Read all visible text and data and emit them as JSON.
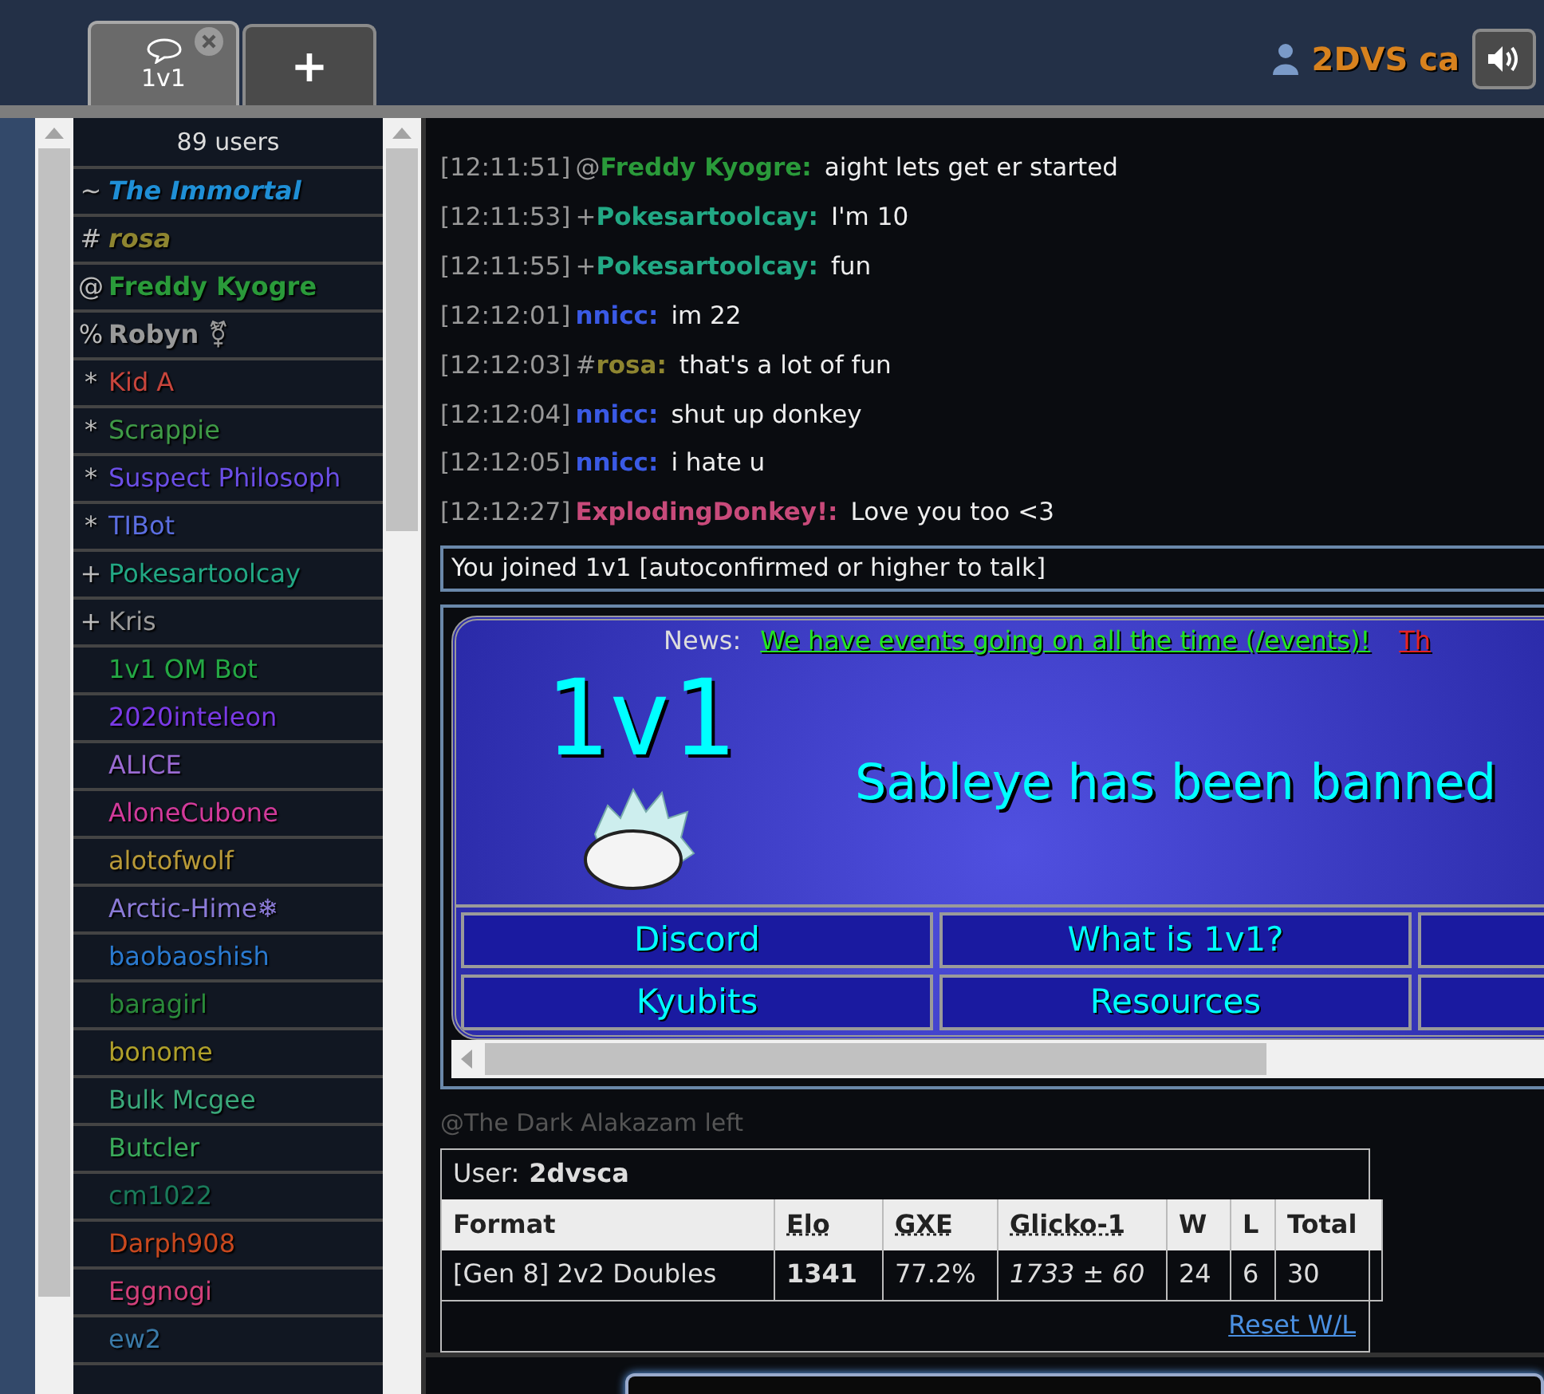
{
  "tabs": [
    {
      "kind": "room",
      "label": "1v1",
      "selected": true
    },
    {
      "kind": "new",
      "label": "+",
      "selected": false
    }
  ],
  "account": {
    "name": "2DVS ca"
  },
  "userlist": {
    "count": "89 users",
    "users": [
      {
        "rank": "~",
        "name": "The Immortal",
        "color": "#1f8fd6",
        "kind": "senior"
      },
      {
        "rank": "#",
        "name": "rosa",
        "color": "#8e8530",
        "kind": "senior"
      },
      {
        "rank": "@",
        "name": "Freddy Kyogre",
        "color": "#2a9a3a",
        "kind": "staff"
      },
      {
        "rank": "%",
        "name": "Robyn ⚧",
        "color": "#999999",
        "kind": "staff"
      },
      {
        "rank": "*",
        "name": "Kid A",
        "color": "#c8453c",
        "kind": "regular"
      },
      {
        "rank": "*",
        "name": "Scrappie",
        "color": "#3f9a46",
        "kind": "regular"
      },
      {
        "rank": "*",
        "name": "Suspect Philosoph",
        "color": "#6b4ee6",
        "kind": "regular"
      },
      {
        "rank": "*",
        "name": "TIBot",
        "color": "#5b6ee0",
        "kind": "regular"
      },
      {
        "rank": "+",
        "name": "Pokesartoolcay",
        "color": "#22a884",
        "kind": "regular"
      },
      {
        "rank": "+",
        "name": "Kris",
        "color": "#9a9a9a",
        "kind": "regular"
      },
      {
        "name": "1v1 OM Bot",
        "color": "#24a844",
        "kind": "regular"
      },
      {
        "name": "2020inteleon",
        "color": "#7a3ae6",
        "kind": "regular"
      },
      {
        "name": "ALICE",
        "color": "#9a6ad2",
        "kind": "regular"
      },
      {
        "name": "AloneCubone",
        "color": "#d23a9a",
        "kind": "regular"
      },
      {
        "name": "alotofwolf",
        "color": "#b89a38",
        "kind": "regular"
      },
      {
        "name": "Arctic-Hime❄",
        "color": "#8a7ad6",
        "kind": "regular"
      },
      {
        "name": "baobaoshish",
        "color": "#2a7ad0",
        "kind": "regular"
      },
      {
        "name": "baragirl",
        "color": "#2a8a3a",
        "kind": "regular"
      },
      {
        "name": "bonome",
        "color": "#b0a02a",
        "kind": "regular"
      },
      {
        "name": "Bulk Mcgee",
        "color": "#3aa87a",
        "kind": "regular"
      },
      {
        "name": "Butcler",
        "color": "#3aaa5a",
        "kind": "regular"
      },
      {
        "name": "cm1022",
        "color": "#1a7a5a",
        "kind": "regular"
      },
      {
        "name": "Darph908",
        "color": "#c8481e",
        "kind": "regular"
      },
      {
        "name": "Eggnogi",
        "color": "#d2407a",
        "kind": "regular"
      },
      {
        "name": "ew2",
        "color": "#3a7aa8",
        "kind": "regular"
      }
    ]
  },
  "chat": {
    "messages": [
      {
        "time": "[12:11:51]",
        "rank": "@",
        "user": "Freddy Kyogre:",
        "color": "#2a9a3a",
        "text": "aight lets get er started"
      },
      {
        "time": "[12:11:53]",
        "rank": "+",
        "user": "Pokesartoolcay:",
        "color": "#22a884",
        "text": "I'm 10"
      },
      {
        "time": "[12:11:55]",
        "rank": "+",
        "user": "Pokesartoolcay:",
        "color": "#22a884",
        "text": "fun"
      },
      {
        "time": "[12:12:01]",
        "user": "nnicc:",
        "color": "#3a5ae6",
        "text": "im 22"
      },
      {
        "time": "[12:12:03]",
        "rank": "#",
        "user": "rosa:",
        "color": "#8e8530",
        "text": "that's a lot of fun"
      },
      {
        "time": "[12:12:04]",
        "user": "nnicc:",
        "color": "#3a5ae6",
        "text": "shut up donkey"
      },
      {
        "time": "[12:12:05]",
        "user": "nnicc:",
        "color": "#3a5ae6",
        "text": "i hate u"
      },
      {
        "time": "[12:12:27]",
        "user": "ExplodingDonkey!:",
        "color": "#c84a7a",
        "text": "Love you too <3"
      }
    ],
    "notice": "You joined 1v1 [autoconfirmed or higher to talk]",
    "banner": {
      "news_label": "News:",
      "news": [
        {
          "text": "We have events going on all the time (/events)!",
          "color": "#22e622"
        },
        {
          "text": "Th",
          "color": "#e62222"
        }
      ],
      "logo": "1v1",
      "headline": "Sableye has been banned",
      "links": [
        [
          "Discord",
          "What is 1v1?"
        ],
        [
          "Kyubits",
          "Resources"
        ]
      ]
    },
    "leave": "@The Dark Alakazam left",
    "ratings": {
      "user_label": "User:",
      "user": "2dvsca",
      "columns": [
        "Format",
        "Elo",
        "GXE",
        "Glicko-1",
        "W",
        "L",
        "Total"
      ],
      "row": [
        "[Gen 8] 2v2 Doubles",
        "1341",
        "77.2%",
        "*1733* ± *60*",
        "24",
        "6",
        "30"
      ],
      "reset": "Reset W/L"
    }
  }
}
